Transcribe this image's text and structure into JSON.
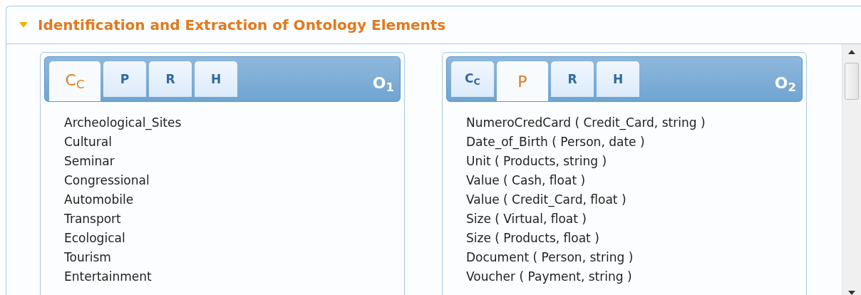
{
  "section": {
    "title": "Identification and Extraction of Ontology Elements",
    "expanded": true
  },
  "panels": [
    {
      "label": "O$_{1}$",
      "tabs": [
        {
          "label": "C$_{C}$",
          "selected": true
        },
        {
          "label": "P",
          "selected": false
        },
        {
          "label": "R",
          "selected": false
        },
        {
          "label": "H",
          "selected": false
        }
      ],
      "items": [
        "Archeological_Sites",
        "Cultural",
        "Seminar",
        "Congressional",
        "Automobile",
        "Transport",
        "Ecological",
        "Tourism",
        "Entertainment"
      ]
    },
    {
      "label": "O$_{2}$",
      "tabs": [
        {
          "label": "C$_{C}$",
          "selected": false
        },
        {
          "label": "P",
          "selected": true
        },
        {
          "label": "R",
          "selected": false
        },
        {
          "label": "H",
          "selected": false
        }
      ],
      "items": [
        "NumeroCredCard ( Credit_Card, string )",
        "Date_of_Birth ( Person, date )",
        "Unit ( Products, string )",
        "Value ( Cash, float )",
        "Value ( Credit_Card, float )",
        "Size ( Virtual, float )",
        "Size ( Products, float )",
        "Document ( Person, string )",
        "Voucher ( Payment, string )"
      ]
    }
  ]
}
